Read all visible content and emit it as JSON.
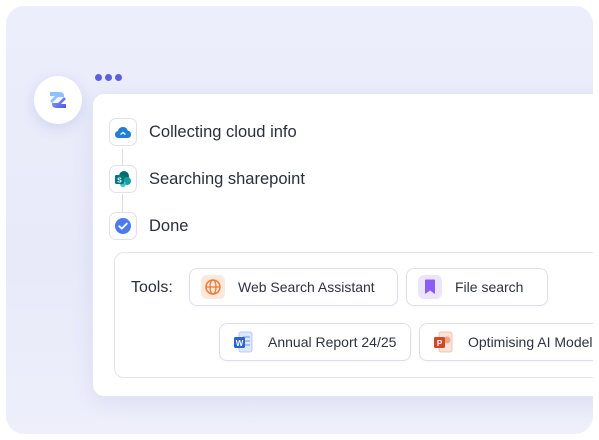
{
  "steps": [
    {
      "label": "Collecting cloud info",
      "icon": "cloud-icon"
    },
    {
      "label": "Searching sharepoint",
      "icon": "sharepoint-icon"
    },
    {
      "label": "Done",
      "icon": "check-icon"
    }
  ],
  "tools": {
    "label": "Tools:",
    "chips": [
      {
        "label": "Web Search Assistant",
        "icon": "globe-icon"
      },
      {
        "label": "File search",
        "icon": "bookmark-icon"
      },
      {
        "label": "Annual Report 24/25",
        "icon": "word-doc-icon"
      },
      {
        "label": "Optimising AI Models",
        "icon": "powerpoint-doc-icon"
      }
    ]
  },
  "colors": {
    "accent": "#5b5fe0",
    "check": "#4c7bf0",
    "web_search": "#f07a3a",
    "file_search": "#8b5cf6",
    "word": "#2b65c9",
    "powerpoint": "#d24726"
  }
}
